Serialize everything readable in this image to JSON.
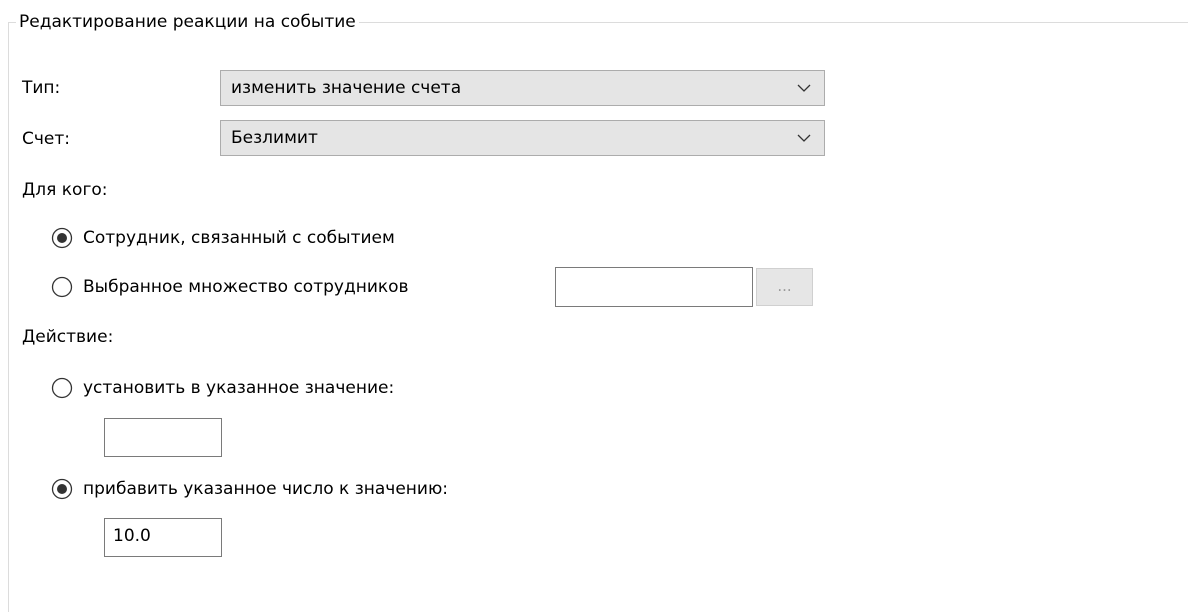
{
  "group": {
    "title": "Редактирование реакции на событие"
  },
  "type": {
    "label": "Тип:",
    "value": "изменить значение счета"
  },
  "account": {
    "label": "Счет:",
    "value": "Безлимит"
  },
  "for_whom": {
    "label": "Для кого:",
    "options": [
      {
        "label": "Сотрудник, связанный с событием",
        "selected": true
      },
      {
        "label": "Выбранное множество сотрудников",
        "selected": false
      }
    ],
    "employees_value": "",
    "browse_label": "..."
  },
  "action": {
    "label": "Действие:",
    "options": [
      {
        "label": "установить в указанное значение:",
        "selected": false,
        "value": ""
      },
      {
        "label": "прибавить указанное число к значению:",
        "selected": true,
        "value": "10.0"
      }
    ]
  },
  "icons": {
    "dropdown": "chevron-down-icon",
    "radio_selected": "radio-selected-icon",
    "radio_unselected": "radio-unselected-icon"
  }
}
